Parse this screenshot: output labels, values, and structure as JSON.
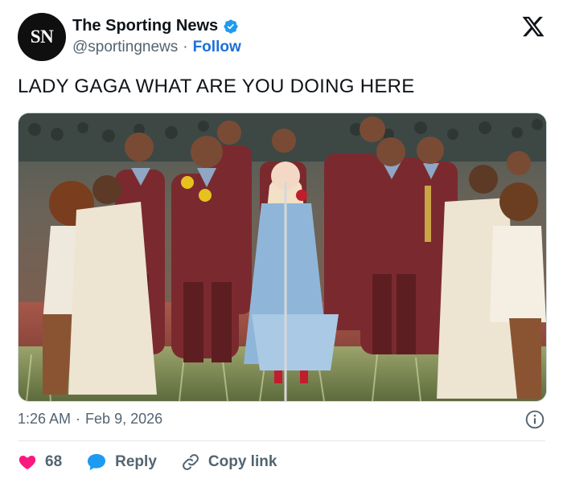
{
  "account": {
    "avatar_text": "SN",
    "display_name": "The Sporting News",
    "handle": "@sportingnews",
    "separator": "·",
    "follow_label": "Follow"
  },
  "tweet": {
    "text": "LADY GAGA WHAT ARE YOU DOING HERE"
  },
  "meta": {
    "time": "1:26 AM",
    "separator": "·",
    "date": "Feb 9, 2026"
  },
  "actions": {
    "like_count": "68",
    "reply_label": "Reply",
    "copy_link_label": "Copy link"
  },
  "colors": {
    "like": "#f91880",
    "reply": "#1d9bf0",
    "follow": "#1d6fd6",
    "verified": "#1d9bf0"
  },
  "icons": [
    "verified-badge-icon",
    "x-logo-icon",
    "info-icon",
    "heart-icon",
    "reply-bubble-icon",
    "link-icon"
  ]
}
